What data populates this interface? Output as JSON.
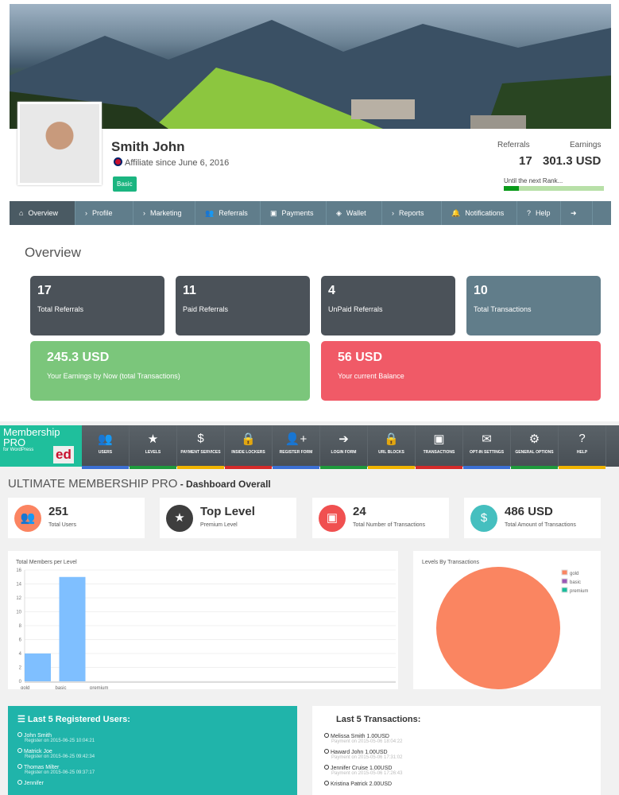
{
  "profile": {
    "name": "Smith John",
    "since": "Affiliate since June 6, 2016",
    "rank_badge": "Basic",
    "referrals_label": "Referrals",
    "earnings_label": "Earnings",
    "referrals": "17",
    "earnings": "301.3 USD",
    "next_rank_label": "Until the next Rank...",
    "next_rank_progress": 0.15
  },
  "nav": [
    {
      "label": "Overview",
      "icon": "home-icon"
    },
    {
      "label": "Profile",
      "icon": "chevron-right-icon"
    },
    {
      "label": "Marketing",
      "icon": "chevron-right-icon"
    },
    {
      "label": "Referrals",
      "icon": "users-icon"
    },
    {
      "label": "Payments",
      "icon": "money-icon"
    },
    {
      "label": "Wallet",
      "icon": "wallet-icon"
    },
    {
      "label": "Reports",
      "icon": "chevron-right-icon"
    },
    {
      "label": "Notifications",
      "icon": "bell-icon"
    },
    {
      "label": "Help",
      "icon": "question-icon"
    },
    {
      "label": "",
      "icon": "logout-icon"
    }
  ],
  "overview": {
    "title": "Overview",
    "cards": [
      {
        "value": "17",
        "label": "Total Referrals",
        "color": "#4b5259"
      },
      {
        "value": "11",
        "label": "Paid Referrals",
        "color": "#4b5259"
      },
      {
        "value": "4",
        "label": "UnPaid Referrals",
        "color": "#4b5259"
      },
      {
        "value": "10",
        "label": "Total Transactions",
        "color": "#617d8a"
      },
      {
        "value": "245.3 USD",
        "label": "Your Earnings by Now (total Transactions)",
        "color": "#7bc67b"
      },
      {
        "value": "56 USD",
        "label": "Your current Balance",
        "color": "#f05a67"
      }
    ]
  },
  "ump": {
    "logo_line1": "Membership",
    "logo_line2": "PRO",
    "logo_line3": "for WordPress",
    "logo_badge": "ed",
    "toolbar": [
      {
        "label": "USERS",
        "icon": "users-icon"
      },
      {
        "label": "LEVELS",
        "icon": "star-icon"
      },
      {
        "label": "PAYMENT SERVICES",
        "icon": "dollar-icon"
      },
      {
        "label": "INSIDE LOCKERS",
        "icon": "lock-icon"
      },
      {
        "label": "REGISTER FORM",
        "icon": "user-plus-icon"
      },
      {
        "label": "LOGIN FORM",
        "icon": "sign-in-icon"
      },
      {
        "label": "URL BLOCKS",
        "icon": "lock-icon"
      },
      {
        "label": "TRANSACTIONS",
        "icon": "money-icon"
      },
      {
        "label": "OPT-IN SETTINGS",
        "icon": "envelope-icon"
      },
      {
        "label": "GENERAL OPTIONS",
        "icon": "gear-icon"
      },
      {
        "label": "HELP",
        "icon": "question-icon"
      }
    ],
    "title_main": "ULTIMATE MEMBERSHIP PRO",
    "title_sub": " - Dashboard Overall",
    "stats": [
      {
        "value": "251",
        "label": "Total Users",
        "color": "#fb8461",
        "icon": "users-icon"
      },
      {
        "value": "Top Level",
        "label": "Premium Level",
        "color": "#3e3e3e",
        "icon": "star-icon"
      },
      {
        "value": "24",
        "label": "Total Number of Transactions",
        "color": "#f05050",
        "icon": "money-icon"
      },
      {
        "value": "486 USD",
        "label": "Total Amount of Transactions",
        "color": "#45bfbf",
        "icon": "dollar-icon"
      }
    ],
    "users_title": "Last 5 Registered Users:",
    "users": [
      {
        "name": "John Smith",
        "date": "Register on 2015-06-25 10:04:21"
      },
      {
        "name": "Matrick Joe",
        "date": "Register on 2015-06-25 09:42:34"
      },
      {
        "name": "Thomas Milter",
        "date": "Register on 2015-06-25 09:37:17"
      },
      {
        "name": "Jennifer",
        "date": ""
      }
    ],
    "tx_title": "Last 5 Transactions:",
    "transactions": [
      {
        "name": "Melissa Smith 1.00USD",
        "date": "Payment on 2015-05-06 18:04:22"
      },
      {
        "name": "Haward John 1.00USD",
        "date": "Payment on 2015-05-06 17:31:02"
      },
      {
        "name": "Jennifer Cruise 1.00USD",
        "date": "Payment on 2015-05-06 17:26:43"
      },
      {
        "name": "Kristina Patrick 2.00USD",
        "date": ""
      }
    ]
  },
  "chart_data": [
    {
      "type": "bar",
      "title": "Total Members per Level",
      "categories": [
        "gold",
        "basic",
        "premium"
      ],
      "values": [
        4,
        15,
        0
      ],
      "ylim": [
        0,
        16
      ],
      "yticks": [
        0,
        2,
        4,
        6,
        8,
        10,
        12,
        14,
        16
      ],
      "color": "#7fbfff",
      "grid": true
    },
    {
      "type": "pie",
      "title": "Levels By Transactions",
      "labels": [
        "gold",
        "basic",
        "premium"
      ],
      "values": [
        1,
        0,
        0
      ],
      "colors": [
        "#fa8561",
        "#9b59b6",
        "#1abc9c"
      ],
      "legend": "top-right"
    }
  ]
}
